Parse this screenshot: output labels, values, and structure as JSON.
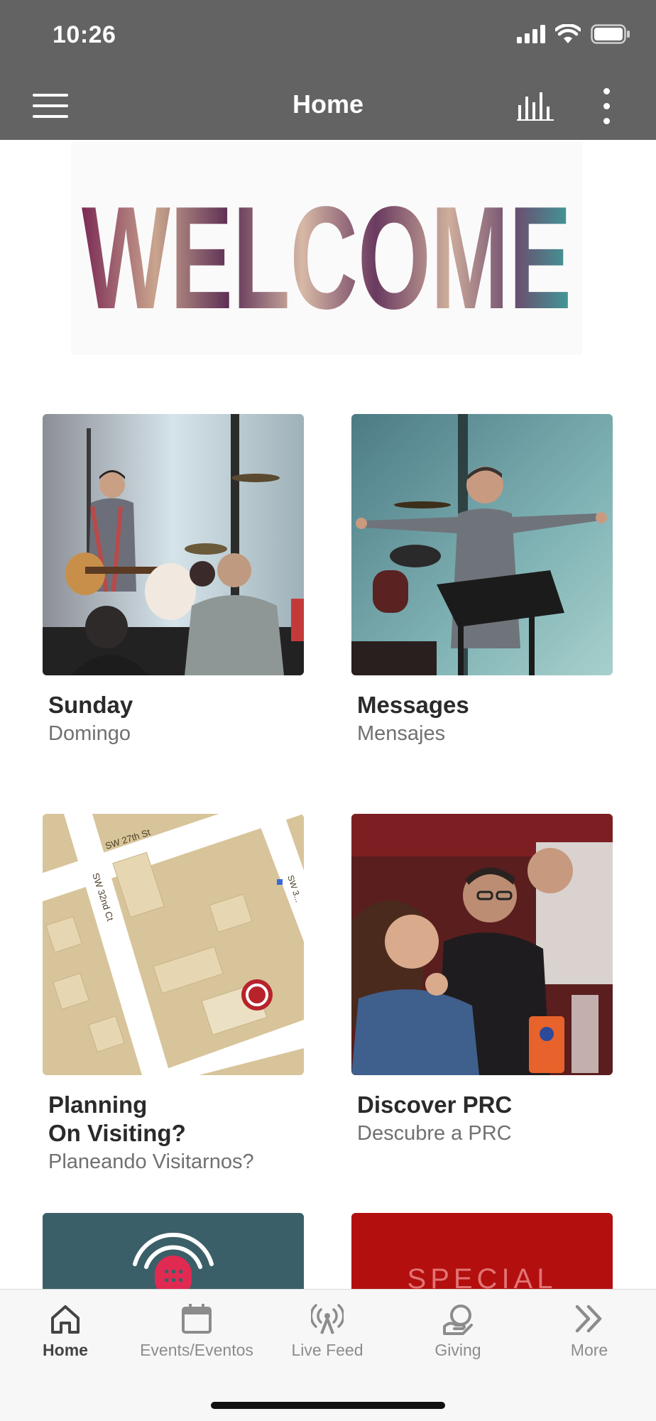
{
  "status_bar": {
    "time": "10:26"
  },
  "header": {
    "title": "Home"
  },
  "banner": {
    "text": "WELCOME"
  },
  "tiles": [
    {
      "title": "Sunday",
      "subtitle": "Domingo"
    },
    {
      "title": "Messages",
      "subtitle": "Mensajes"
    },
    {
      "title": "Planning\nOn Visiting?",
      "subtitle": "Planeando Visitarnos?"
    },
    {
      "title": "Discover PRC",
      "subtitle": "Descubre a PRC"
    }
  ],
  "map": {
    "street_1": "SW 27th St",
    "street_2": "SW 32nd Ct",
    "street_3": "SW 3..."
  },
  "partial_tiles": [
    {
      "icon": "live-broadcast-icon",
      "color": "#3b5f68"
    },
    {
      "text": "SPECIAL",
      "color": "#b30f0f"
    }
  ],
  "tab_bar": {
    "tabs": [
      {
        "label": "Home",
        "icon": "home-icon",
        "active": true
      },
      {
        "label": "Events/Eventos",
        "icon": "calendar-icon",
        "active": false
      },
      {
        "label": "Live Feed",
        "icon": "broadcast-icon",
        "active": false
      },
      {
        "label": "Giving",
        "icon": "giving-icon",
        "active": false
      },
      {
        "label": "More",
        "icon": "chevrons-right-icon",
        "active": false
      }
    ]
  },
  "colors": {
    "header": "#636363",
    "accent_red": "#b30f0f",
    "teal": "#3b5f68"
  }
}
